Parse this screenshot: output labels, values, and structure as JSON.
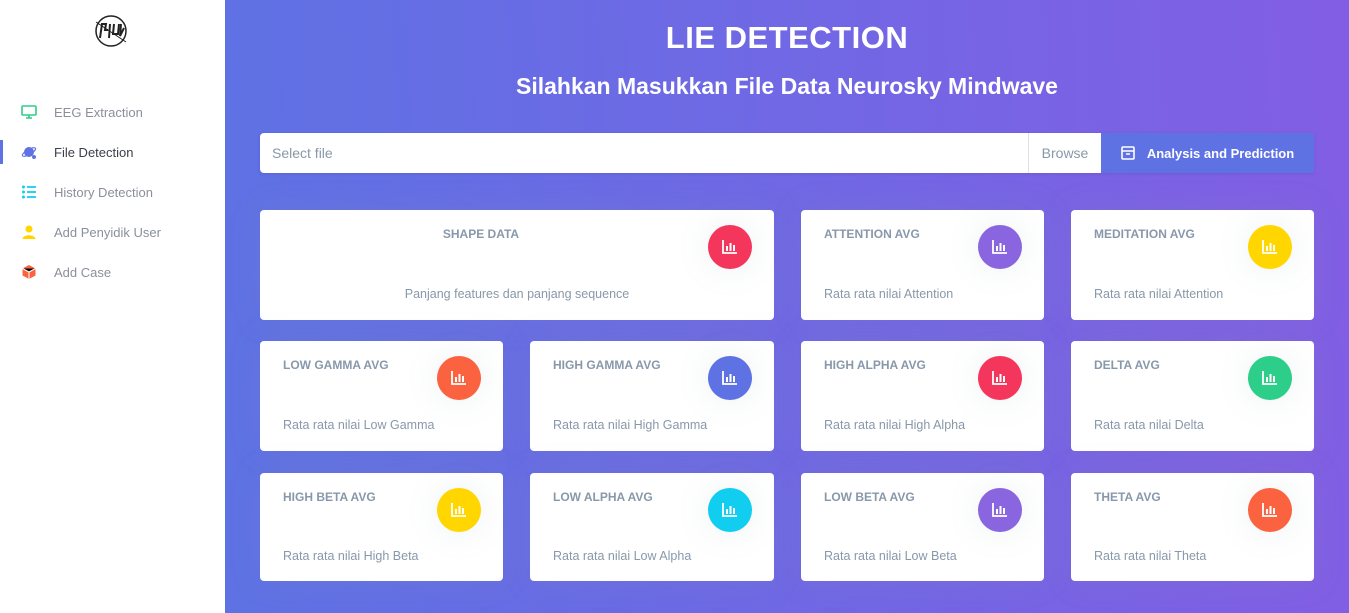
{
  "sidebar": {
    "items": [
      {
        "label": "EEG Extraction",
        "icon": "monitor-icon",
        "color": "#2dce89"
      },
      {
        "label": "File Detection",
        "icon": "planet-icon",
        "color": "#5e72e4"
      },
      {
        "label": "History Detection",
        "icon": "list-icon",
        "color": "#11cdef"
      },
      {
        "label": "Add Penyidik User",
        "icon": "user-icon",
        "color": "#ffd600"
      },
      {
        "label": "Add Case",
        "icon": "box-icon",
        "color": "#fb6340"
      }
    ]
  },
  "header": {
    "title": "LIE DETECTION",
    "subtitle": "Silahkan Masukkan File Data Neurosky Mindwave"
  },
  "upload": {
    "placeholder": "Select file",
    "browse_label": "Browse",
    "analyze_label": "Analysis and Prediction"
  },
  "cards": [
    {
      "title": "SHAPE DATA",
      "sub": "Panjang features dan panjang sequence",
      "color": "#f5365c"
    },
    {
      "title": "ATTENTION AVG",
      "sub": "Rata rata nilai Attention",
      "color": "#8965e0"
    },
    {
      "title": "MEDITATION AVG",
      "sub": "Rata rata nilai Attention",
      "color": "#ffd600"
    },
    {
      "title": "LOW GAMMA AVG",
      "sub": "Rata rata nilai Low Gamma",
      "color": "#fb6340"
    },
    {
      "title": "HIGH GAMMA AVG",
      "sub": "Rata rata nilai High Gamma",
      "color": "#5e72e4"
    },
    {
      "title": "HIGH ALPHA AVG",
      "sub": "Rata rata nilai High Alpha",
      "color": "#f5365c"
    },
    {
      "title": "DELTA AVG",
      "sub": "Rata rata nilai Delta",
      "color": "#2dce89"
    },
    {
      "title": "HIGH BETA AVG",
      "sub": "Rata rata nilai High Beta",
      "color": "#ffd600"
    },
    {
      "title": "LOW ALPHA AVG",
      "sub": "Rata rata nilai Low Alpha",
      "color": "#11cdef"
    },
    {
      "title": "LOW BETA AVG",
      "sub": "Rata rata nilai Low Beta",
      "color": "#8965e0"
    },
    {
      "title": "THETA AVG",
      "sub": "Rata rata nilai Theta",
      "color": "#fb6340"
    }
  ]
}
